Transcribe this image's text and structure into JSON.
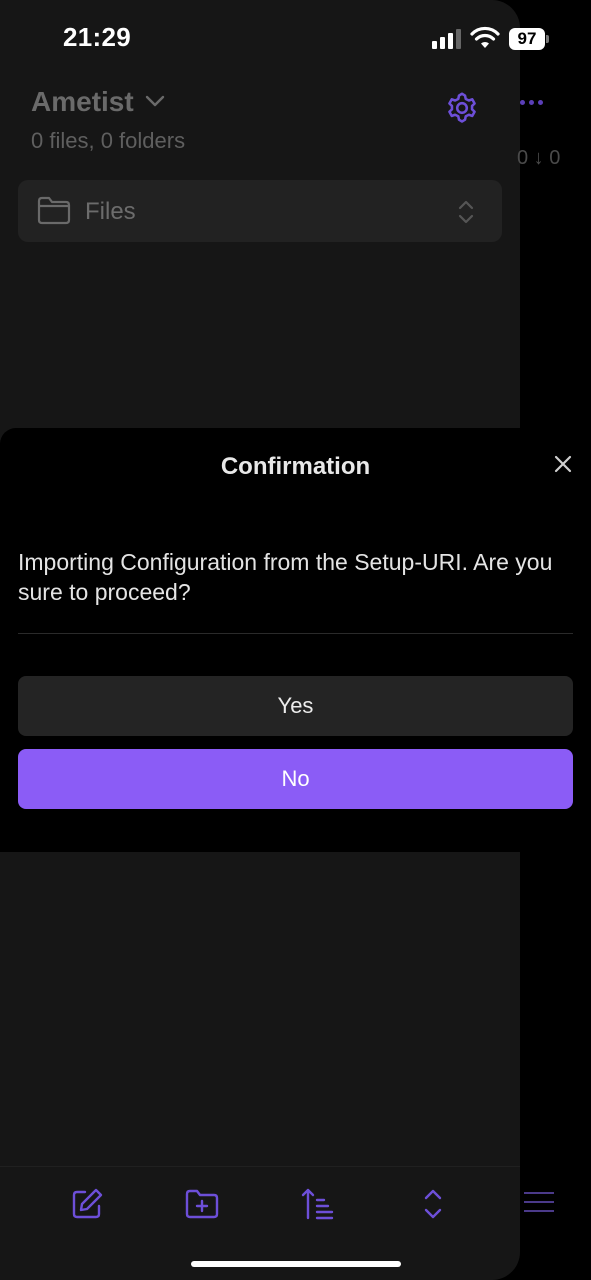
{
  "status_bar": {
    "time": "21:29",
    "battery": "97"
  },
  "vault": {
    "name": "Ametist",
    "stats": "0 files, 0 folders"
  },
  "file_nav": {
    "label": "Files"
  },
  "background": {
    "counts_text": "0 ↓ 0"
  },
  "dialog": {
    "title": "Confirmation",
    "message": "Importing Configuration from the Setup-URI. Are you sure to proceed?",
    "yes_label": "Yes",
    "no_label": "No"
  },
  "colors": {
    "accent": "#8b5cf6",
    "icon_purple": "#6d4fd8"
  },
  "icons": [
    "gear-icon",
    "chevron-down-icon",
    "folder-icon",
    "up-down-icon",
    "close-icon",
    "new-note-icon",
    "new-folder-icon",
    "sort-icon",
    "collapse-icon",
    "menu-icon"
  ]
}
